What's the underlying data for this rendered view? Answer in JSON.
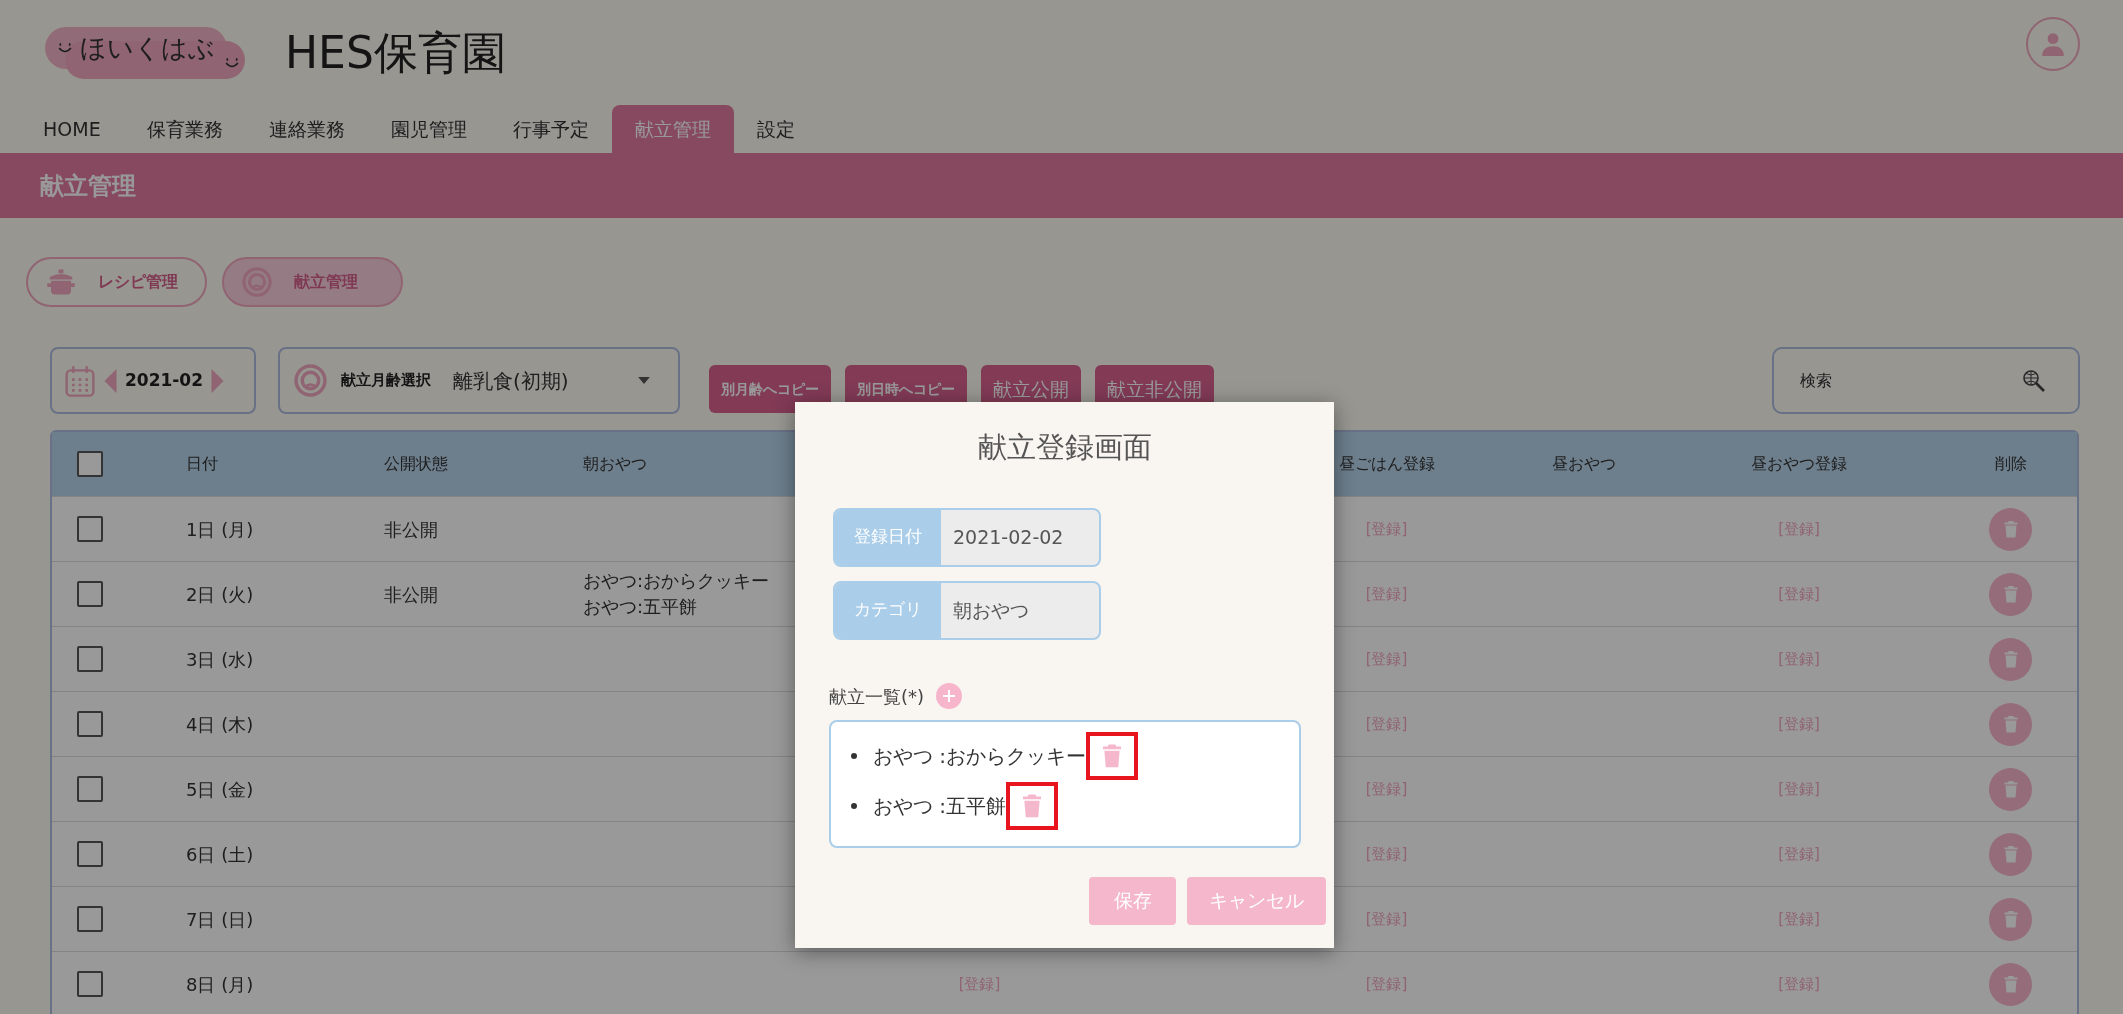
{
  "logo": {
    "text": "ほいくはぶ"
  },
  "site_title": "HES保育園",
  "nav": [
    {
      "label": "HOME",
      "selected": false
    },
    {
      "label": "保育業務",
      "selected": false
    },
    {
      "label": "連絡業務",
      "selected": false
    },
    {
      "label": "園児管理",
      "selected": false
    },
    {
      "label": "行事予定",
      "selected": false
    },
    {
      "label": "献立管理",
      "selected": true
    },
    {
      "label": "設定",
      "selected": false
    }
  ],
  "page_title": "献立管理",
  "sub_tabs": [
    {
      "label": "レシピ管理",
      "kind": "pot",
      "selected": false
    },
    {
      "label": "献立管理",
      "kind": "face",
      "selected": true
    }
  ],
  "month": "2021-02",
  "age_select": {
    "label": "献立月齢選択",
    "value": "離乳食(初期)"
  },
  "actions": [
    {
      "label": "別月齢へコピー",
      "kind": "small"
    },
    {
      "label": "別日時へコピー",
      "kind": "small"
    },
    {
      "label": "献立公開",
      "kind": "large"
    },
    {
      "label": "献立非公開",
      "kind": "large"
    }
  ],
  "search": {
    "placeholder": "検索"
  },
  "table": {
    "select_all_checked": false,
    "columns": [
      "日付",
      "公開状態",
      "朝おやつ",
      "昼ごはん登録",
      "昼おやつ",
      "昼おやつ登録",
      "削除"
    ],
    "rows": [
      {
        "checked": false,
        "date": "1日 (月)",
        "status": "非公開",
        "morning_snack": [],
        "lunch_register": "[登録]",
        "snack_register": "[登録]"
      },
      {
        "checked": false,
        "date": "2日 (火)",
        "status": "非公開",
        "morning_snack": [
          "おやつ:おからクッキー",
          "おやつ:五平餅"
        ],
        "lunch_register": "[登録]",
        "snack_register": "[登録]"
      },
      {
        "checked": false,
        "date": "3日 (水)",
        "morning_snack": [],
        "lunch_register": "[登録]",
        "snack_register": "[登録]"
      },
      {
        "checked": false,
        "date": "4日 (木)",
        "morning_snack": [],
        "lunch_register": "[登録]",
        "snack_register": "[登録]"
      },
      {
        "checked": false,
        "date": "5日 (金)",
        "morning_snack": [],
        "lunch_register": "[登録]",
        "snack_register": "[登録]"
      },
      {
        "checked": false,
        "date": "6日 (土)",
        "morning_snack": [],
        "lunch_register": "[登録]",
        "snack_register": "[登録]"
      },
      {
        "checked": false,
        "date": "7日 (日)",
        "morning_snack": [],
        "lunch_register": "[登録]",
        "snack_register": "[登録]"
      },
      {
        "checked": false,
        "date": "8日 (月)",
        "morning_snack": [],
        "morning_register": "[登録]",
        "lunch_register": "[登録]",
        "snack_register": "[登録]"
      }
    ]
  },
  "modal": {
    "title": "献立登録画面",
    "fields": [
      {
        "label": "登録日付",
        "value": "2021-02-02"
      },
      {
        "label": "カテゴリ",
        "value": "朝おやつ"
      }
    ],
    "list_label": "献立一覧(*)",
    "items": [
      {
        "text": "おやつ :おからクッキー",
        "highlighted": true
      },
      {
        "text": "おやつ :五平餅",
        "highlighted": true
      }
    ],
    "buttons": [
      "保存",
      "キャンセル"
    ]
  }
}
